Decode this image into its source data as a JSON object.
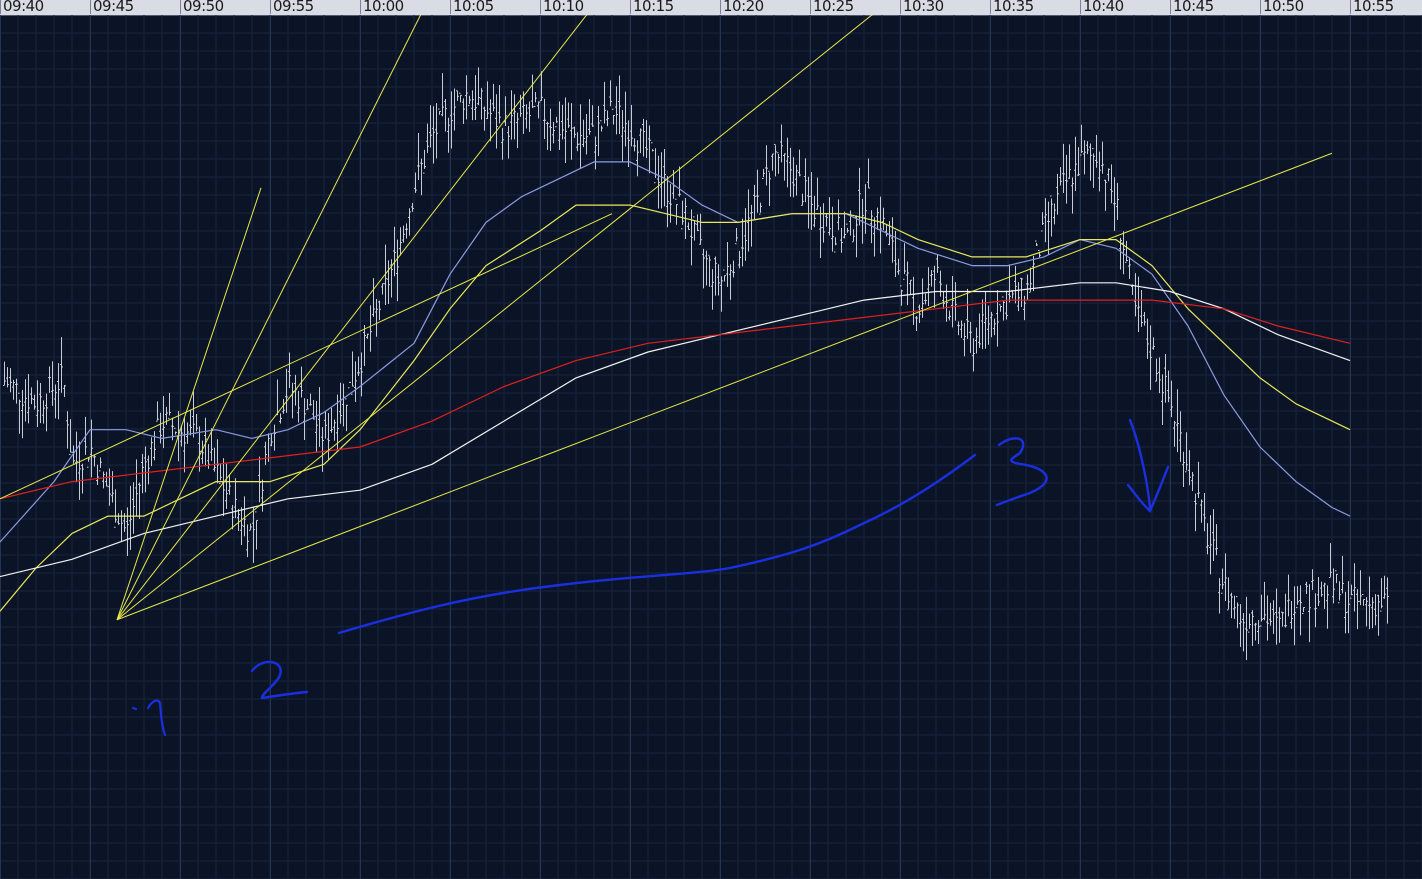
{
  "chart_data": {
    "type": "line",
    "time_axis_ticks": [
      "09:40",
      "09:45",
      "09:50",
      "09:55",
      "10:00",
      "10:05",
      "10:10",
      "10:15",
      "10:20",
      "10:25",
      "10:30",
      "10:35",
      "10:40",
      "10:45",
      "10:50",
      "10:55"
    ],
    "x_range": [
      "09:40",
      "10:55"
    ],
    "grid": true,
    "price_bars": "approximate OHLC price bars, one per ~10 seconds, trace rising from 09:47 to a high near 10:15 then falling after 10:42",
    "close": [
      {
        "t": "09:40",
        "v": 0.58
      },
      {
        "t": "09:42",
        "v": 0.55
      },
      {
        "t": "09:43.5",
        "v": 0.58
      },
      {
        "t": "09:44",
        "v": 0.48
      },
      {
        "t": "09:45",
        "v": 0.5
      },
      {
        "t": "09:46",
        "v": 0.45
      },
      {
        "t": "09:47",
        "v": 0.4
      },
      {
        "t": "09:48",
        "v": 0.48
      },
      {
        "t": "09:49",
        "v": 0.53
      },
      {
        "t": "09:51",
        "v": 0.51
      },
      {
        "t": "09:52.5",
        "v": 0.45
      },
      {
        "t": "09:53",
        "v": 0.43
      },
      {
        "t": "09:54",
        "v": 0.4
      },
      {
        "t": "09:55",
        "v": 0.52
      },
      {
        "t": "09:56",
        "v": 0.57
      },
      {
        "t": "09:57",
        "v": 0.55
      },
      {
        "t": "09:58",
        "v": 0.51
      },
      {
        "t": "09:59",
        "v": 0.55
      },
      {
        "t": "10:00",
        "v": 0.6
      },
      {
        "t": "10:01",
        "v": 0.66
      },
      {
        "t": "10:02",
        "v": 0.72
      },
      {
        "t": "10:03",
        "v": 0.8
      },
      {
        "t": "10:04",
        "v": 0.86
      },
      {
        "t": "10:05",
        "v": 0.89
      },
      {
        "t": "10:06",
        "v": 0.91
      },
      {
        "t": "10:07",
        "v": 0.89
      },
      {
        "t": "10:08",
        "v": 0.87
      },
      {
        "t": "10:09",
        "v": 0.88
      },
      {
        "t": "10:10",
        "v": 0.89
      },
      {
        "t": "10:11",
        "v": 0.87
      },
      {
        "t": "10:12",
        "v": 0.86
      },
      {
        "t": "10:13",
        "v": 0.86
      },
      {
        "t": "10:14",
        "v": 0.89
      },
      {
        "t": "10:15",
        "v": 0.87
      },
      {
        "t": "10:16",
        "v": 0.84
      },
      {
        "t": "10:17",
        "v": 0.8
      },
      {
        "t": "10:18",
        "v": 0.77
      },
      {
        "t": "10:19",
        "v": 0.72
      },
      {
        "t": "10:20",
        "v": 0.69
      },
      {
        "t": "10:21",
        "v": 0.73
      },
      {
        "t": "10:22",
        "v": 0.78
      },
      {
        "t": "10:23",
        "v": 0.84
      },
      {
        "t": "10:24",
        "v": 0.82
      },
      {
        "t": "10:25",
        "v": 0.78
      },
      {
        "t": "10:26",
        "v": 0.76
      },
      {
        "t": "10:27",
        "v": 0.74
      },
      {
        "t": "10:28",
        "v": 0.79
      },
      {
        "t": "10:29",
        "v": 0.76
      },
      {
        "t": "10:30",
        "v": 0.7
      },
      {
        "t": "10:31",
        "v": 0.66
      },
      {
        "t": "10:32",
        "v": 0.7
      },
      {
        "t": "10:33",
        "v": 0.65
      },
      {
        "t": "10:34",
        "v": 0.62
      },
      {
        "t": "10:35",
        "v": 0.65
      },
      {
        "t": "10:36",
        "v": 0.67
      },
      {
        "t": "10:37",
        "v": 0.68
      },
      {
        "t": "10:38",
        "v": 0.75
      },
      {
        "t": "10:39",
        "v": 0.8
      },
      {
        "t": "10:40",
        "v": 0.83
      },
      {
        "t": "10:41",
        "v": 0.84
      },
      {
        "t": "10:42",
        "v": 0.78
      },
      {
        "t": "10:43",
        "v": 0.66
      },
      {
        "t": "10:44",
        "v": 0.61
      },
      {
        "t": "10:45",
        "v": 0.55
      },
      {
        "t": "10:46",
        "v": 0.48
      },
      {
        "t": "10:47",
        "v": 0.4
      },
      {
        "t": "10:48",
        "v": 0.34
      },
      {
        "t": "10:49",
        "v": 0.3
      },
      {
        "t": "10:50",
        "v": 0.31
      },
      {
        "t": "10:51",
        "v": 0.29
      },
      {
        "t": "10:52",
        "v": 0.33
      },
      {
        "t": "10:53",
        "v": 0.33
      },
      {
        "t": "10:54",
        "v": 0.34
      },
      {
        "t": "10:55",
        "v": 0.32
      }
    ],
    "series": [
      {
        "key": "blue-ma",
        "color": "#8a9be0",
        "points": [
          {
            "t": "09:40",
            "v": 0.39
          },
          {
            "t": "09:43",
            "v": 0.46
          },
          {
            "t": "09:45",
            "v": 0.52
          },
          {
            "t": "09:47",
            "v": 0.52
          },
          {
            "t": "09:49",
            "v": 0.51
          },
          {
            "t": "09:52",
            "v": 0.52
          },
          {
            "t": "09:54",
            "v": 0.51
          },
          {
            "t": "09:56",
            "v": 0.52
          },
          {
            "t": "09:58",
            "v": 0.54
          },
          {
            "t": "10:00",
            "v": 0.57
          },
          {
            "t": "10:03",
            "v": 0.62
          },
          {
            "t": "10:05",
            "v": 0.7
          },
          {
            "t": "10:07",
            "v": 0.76
          },
          {
            "t": "10:09",
            "v": 0.79
          },
          {
            "t": "10:11",
            "v": 0.81
          },
          {
            "t": "10:13",
            "v": 0.83
          },
          {
            "t": "10:15",
            "v": 0.83
          },
          {
            "t": "10:17",
            "v": 0.81
          },
          {
            "t": "10:19",
            "v": 0.78
          },
          {
            "t": "10:21",
            "v": 0.76
          },
          {
            "t": "10:24",
            "v": 0.77
          },
          {
            "t": "10:27",
            "v": 0.77
          },
          {
            "t": "10:29",
            "v": 0.75
          },
          {
            "t": "10:31",
            "v": 0.73
          },
          {
            "t": "10:34",
            "v": 0.71
          },
          {
            "t": "10:36",
            "v": 0.71
          },
          {
            "t": "10:38",
            "v": 0.72
          },
          {
            "t": "10:40",
            "v": 0.74
          },
          {
            "t": "10:42",
            "v": 0.73
          },
          {
            "t": "10:44",
            "v": 0.7
          },
          {
            "t": "10:46",
            "v": 0.64
          },
          {
            "t": "10:48",
            "v": 0.56
          },
          {
            "t": "10:50",
            "v": 0.5
          },
          {
            "t": "10:52",
            "v": 0.46
          },
          {
            "t": "10:54",
            "v": 0.43
          },
          {
            "t": "10:55",
            "v": 0.42
          }
        ]
      },
      {
        "key": "yellow-ma",
        "color": "#e8e85a",
        "points": [
          {
            "t": "09:40",
            "v": 0.31
          },
          {
            "t": "09:42",
            "v": 0.36
          },
          {
            "t": "09:44",
            "v": 0.4
          },
          {
            "t": "09:46",
            "v": 0.42
          },
          {
            "t": "09:48",
            "v": 0.42
          },
          {
            "t": "09:50",
            "v": 0.44
          },
          {
            "t": "09:52",
            "v": 0.46
          },
          {
            "t": "09:55",
            "v": 0.46
          },
          {
            "t": "09:58",
            "v": 0.48
          },
          {
            "t": "10:00",
            "v": 0.52
          },
          {
            "t": "10:03",
            "v": 0.6
          },
          {
            "t": "10:05",
            "v": 0.66
          },
          {
            "t": "10:07",
            "v": 0.71
          },
          {
            "t": "10:10",
            "v": 0.75
          },
          {
            "t": "10:12",
            "v": 0.78
          },
          {
            "t": "10:15",
            "v": 0.78
          },
          {
            "t": "10:17",
            "v": 0.77
          },
          {
            "t": "10:19",
            "v": 0.76
          },
          {
            "t": "10:21",
            "v": 0.76
          },
          {
            "t": "10:24",
            "v": 0.77
          },
          {
            "t": "10:27",
            "v": 0.77
          },
          {
            "t": "10:29",
            "v": 0.76
          },
          {
            "t": "10:31",
            "v": 0.74
          },
          {
            "t": "10:34",
            "v": 0.72
          },
          {
            "t": "10:37",
            "v": 0.72
          },
          {
            "t": "10:40",
            "v": 0.74
          },
          {
            "t": "10:42",
            "v": 0.74
          },
          {
            "t": "10:44",
            "v": 0.71
          },
          {
            "t": "10:46",
            "v": 0.66
          },
          {
            "t": "10:48",
            "v": 0.62
          },
          {
            "t": "10:50",
            "v": 0.58
          },
          {
            "t": "10:52",
            "v": 0.55
          },
          {
            "t": "10:55",
            "v": 0.52
          }
        ]
      },
      {
        "key": "white-ma",
        "color": "#f2f2f2",
        "points": [
          {
            "t": "09:40",
            "v": 0.35
          },
          {
            "t": "09:44",
            "v": 0.37
          },
          {
            "t": "09:48",
            "v": 0.4
          },
          {
            "t": "09:52",
            "v": 0.42
          },
          {
            "t": "09:56",
            "v": 0.44
          },
          {
            "t": "10:00",
            "v": 0.45
          },
          {
            "t": "10:04",
            "v": 0.48
          },
          {
            "t": "10:08",
            "v": 0.53
          },
          {
            "t": "10:12",
            "v": 0.58
          },
          {
            "t": "10:16",
            "v": 0.61
          },
          {
            "t": "10:20",
            "v": 0.63
          },
          {
            "t": "10:24",
            "v": 0.65
          },
          {
            "t": "10:28",
            "v": 0.67
          },
          {
            "t": "10:32",
            "v": 0.68
          },
          {
            "t": "10:36",
            "v": 0.68
          },
          {
            "t": "10:40",
            "v": 0.69
          },
          {
            "t": "10:42",
            "v": 0.69
          },
          {
            "t": "10:45",
            "v": 0.68
          },
          {
            "t": "10:48",
            "v": 0.66
          },
          {
            "t": "10:51",
            "v": 0.63
          },
          {
            "t": "10:55",
            "v": 0.6
          }
        ]
      },
      {
        "key": "red-ma",
        "color": "#e02020",
        "points": [
          {
            "t": "09:40",
            "v": 0.44
          },
          {
            "t": "09:44",
            "v": 0.46
          },
          {
            "t": "09:48",
            "v": 0.47
          },
          {
            "t": "09:52",
            "v": 0.48
          },
          {
            "t": "09:56",
            "v": 0.49
          },
          {
            "t": "10:00",
            "v": 0.5
          },
          {
            "t": "10:04",
            "v": 0.53
          },
          {
            "t": "10:08",
            "v": 0.57
          },
          {
            "t": "10:12",
            "v": 0.6
          },
          {
            "t": "10:16",
            "v": 0.62
          },
          {
            "t": "10:20",
            "v": 0.63
          },
          {
            "t": "10:24",
            "v": 0.64
          },
          {
            "t": "10:28",
            "v": 0.65
          },
          {
            "t": "10:32",
            "v": 0.66
          },
          {
            "t": "10:36",
            "v": 0.67
          },
          {
            "t": "10:40",
            "v": 0.67
          },
          {
            "t": "10:44",
            "v": 0.67
          },
          {
            "t": "10:48",
            "v": 0.66
          },
          {
            "t": "10:51",
            "v": 0.64
          },
          {
            "t": "10:55",
            "v": 0.62
          }
        ]
      }
    ],
    "fan_origin": {
      "t": "09:46.5",
      "v": 0.3
    },
    "fan_lines": [
      {
        "t": "09:54.5",
        "v": 0.8
      },
      {
        "t": "10:13",
        "v": 1.4
      },
      {
        "t": "10:26",
        "v": 1.36
      },
      {
        "t": "10:50",
        "v": 1.36
      },
      {
        "t": "10:54",
        "v": 0.84
      }
    ],
    "extra_lines": [
      {
        "from": {
          "t": "09:40",
          "v": 0.44
        },
        "to": {
          "t": "10:14",
          "v": 0.77
        }
      }
    ],
    "annotations": [
      {
        "text": "1",
        "t": "09:46.5",
        "v": 0.22
      },
      {
        "text": "2",
        "t": "09:54",
        "v": 0.26
      },
      {
        "text": "3",
        "t": "10:35",
        "v": 0.6
      },
      {
        "text": "↓",
        "t": "10:43",
        "v": 0.57
      }
    ],
    "ylim": [
      0,
      1.0
    ]
  }
}
